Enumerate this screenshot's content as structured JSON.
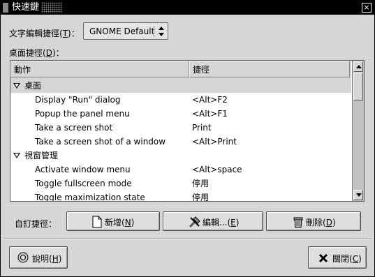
{
  "window": {
    "title": "快速鍵",
    "close_glyph": "×"
  },
  "text_editing": {
    "label": "文字編輯捷徑(",
    "mnemonic": "T",
    "label_end": ")：",
    "value": "GNOME Default"
  },
  "desktop_shortcuts": {
    "label": "桌面捷徑(",
    "mnemonic": "D",
    "label_end": ")："
  },
  "table": {
    "columns": [
      "動作",
      "捷徑"
    ],
    "categories": [
      {
        "name": "桌面",
        "items": [
          {
            "action": "Display \"Run\" dialog",
            "shortcut": "<Alt>F2"
          },
          {
            "action": "Popup the panel menu",
            "shortcut": "<Alt>F1"
          },
          {
            "action": "Take a screen shot",
            "shortcut": "Print"
          },
          {
            "action": "Take a screen shot of a window",
            "shortcut": "<Alt>Print"
          }
        ]
      },
      {
        "name": "視窗管理",
        "items": [
          {
            "action": "Activate window menu",
            "shortcut": "<Alt>space"
          },
          {
            "action": "Toggle fullscreen mode",
            "shortcut": "停用"
          },
          {
            "action": "Toggle maximization state",
            "shortcut": "停用"
          }
        ]
      }
    ]
  },
  "custom": {
    "label": "自訂捷徑：",
    "new_button": {
      "label": "新增(",
      "mnemonic": "N",
      "label_end": ")"
    },
    "edit_button": {
      "label": "編輯...(",
      "mnemonic": "E",
      "label_end": ")"
    },
    "delete_button": {
      "label": "刪除(",
      "mnemonic": "D",
      "label_end": ")"
    }
  },
  "footer": {
    "help_button": {
      "label": "說明(",
      "mnemonic": "H",
      "label_end": ")"
    },
    "close_button": {
      "label": "關閉(",
      "mnemonic": "C",
      "label_end": ")"
    }
  }
}
